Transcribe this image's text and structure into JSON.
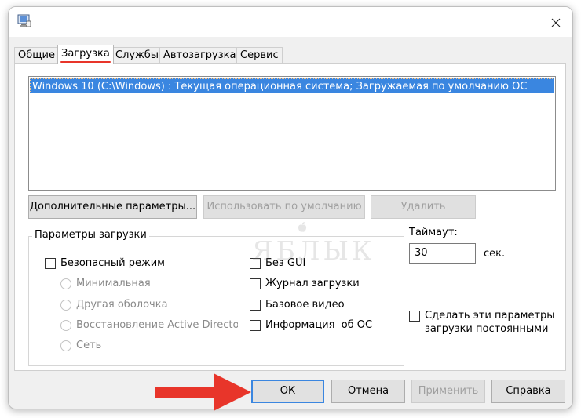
{
  "tabs": [
    {
      "label": "Общие",
      "active": false
    },
    {
      "label": "Загрузка",
      "active": true
    },
    {
      "label": "Службы",
      "active": false
    },
    {
      "label": "Автозагрузка",
      "active": false
    },
    {
      "label": "Сервис",
      "active": false
    }
  ],
  "os_list": {
    "items": [
      "Windows 10 (C:\\Windows) : Текущая операционная система; Загружаемая по умолчанию ОС"
    ]
  },
  "list_buttons": {
    "advanced": "Дополнительные параметры...",
    "set_default": "Использовать по умолчанию",
    "delete": "Удалить"
  },
  "watermark": "ЯБЛЫК",
  "boot_options": {
    "title": "Параметры загрузки",
    "safe_boot": {
      "label": "Безопасный режим",
      "checked": false
    },
    "radios": [
      "Минимальная",
      "Другая оболочка",
      "Восстановление Active Directory",
      "Сеть"
    ],
    "no_gui": {
      "label": "Без GUI",
      "checked": false
    },
    "boot_log": {
      "label": "Журнал загрузки",
      "checked": false
    },
    "base_video": {
      "label": "Базовое видео",
      "checked": false
    },
    "os_info": {
      "label": "Информация  об ОС",
      "checked": false
    }
  },
  "timeout": {
    "label": "Таймаут:",
    "value": "30",
    "unit": "сек."
  },
  "make_permanent": {
    "line1": "Сделать эти параметры",
    "line2": "загрузки постоянными",
    "checked": false
  },
  "dialog_buttons": {
    "ok": "ОК",
    "cancel": "Отмена",
    "apply": "Применить",
    "help": "Справка"
  },
  "colors": {
    "selection": "#3a86e0",
    "arrow": "#e8352a",
    "tab_underline": "#e8352a"
  }
}
